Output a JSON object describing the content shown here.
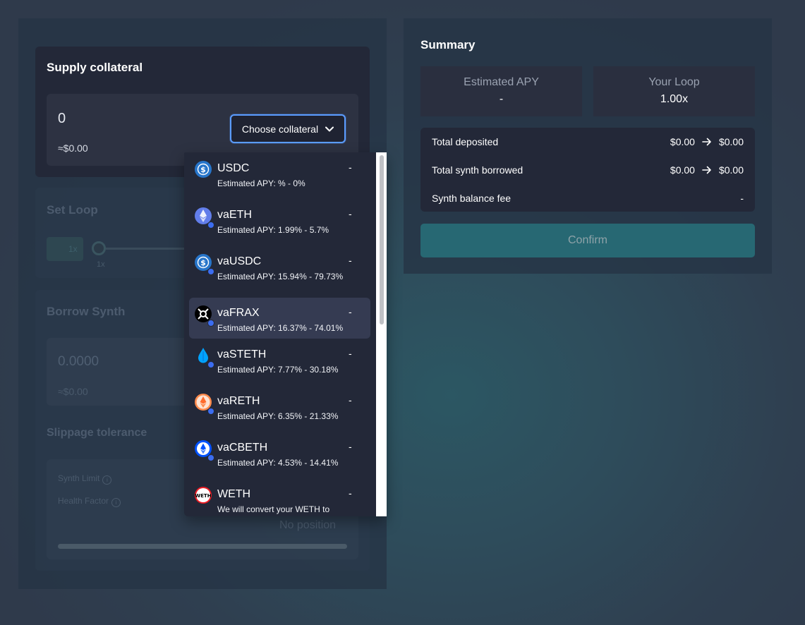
{
  "supply": {
    "title": "Supply collateral",
    "amount": "0",
    "usd": "≈$0.00",
    "choose_label": "Choose collateral"
  },
  "loop": {
    "title": "Set Loop",
    "chip_value": "1x",
    "slider_min": "1x"
  },
  "borrow": {
    "title": "Borrow Synth",
    "amount": "0.0000",
    "usd": "≈$0.00",
    "slippage_title": "Slippage tolerance",
    "synth_limit_label": "Synth Limit",
    "health_factor_label": "Health Factor",
    "no_position": "No position"
  },
  "dropdown": {
    "options": [
      {
        "name": "USDC",
        "apy": "Estimated APY: % - 0%",
        "value": "-",
        "icon": "usdc-icon",
        "color": "#2775ca"
      },
      {
        "name": "vaETH",
        "apy": "Estimated APY: 1.99% - 5.7%",
        "value": "-",
        "icon": "eth-icon",
        "color": "#627eea"
      },
      {
        "name": "vaUSDC",
        "apy": "Estimated APY: 15.94% - 79.73%",
        "value": "-",
        "icon": "usdc-icon",
        "color": "#2775ca"
      },
      {
        "name": "vaFRAX",
        "apy": "Estimated APY: 16.37% - 74.01%",
        "value": "-",
        "icon": "frax-icon",
        "color": "#000000"
      },
      {
        "name": "vaSTETH",
        "apy": "Estimated APY: 7.77% - 30.18%",
        "value": "-",
        "icon": "steth-icon",
        "color": "#00a3ff"
      },
      {
        "name": "vaRETH",
        "apy": "Estimated APY: 6.35% - 21.33%",
        "value": "-",
        "icon": "reth-icon",
        "color": "#ff8a4c"
      },
      {
        "name": "vaCBETH",
        "apy": "Estimated APY: 4.53% - 14.41%",
        "value": "-",
        "icon": "cbeth-icon",
        "color": "#0052ff"
      },
      {
        "name": "WETH",
        "apy": "We will convert your WETH to",
        "value": "-",
        "icon": "weth-icon",
        "color": "#ffffff"
      }
    ]
  },
  "summary": {
    "title": "Summary",
    "estimated_apy_label": "Estimated APY",
    "estimated_apy_value": "-",
    "your_loop_label": "Your Loop",
    "your_loop_value": "1.00x",
    "total_deposited_label": "Total deposited",
    "total_deposited_from": "$0.00",
    "total_deposited_to": "$0.00",
    "total_borrowed_label": "Total synth borrowed",
    "total_borrowed_from": "$0.00",
    "total_borrowed_to": "$0.00",
    "balance_fee_label": "Synth balance fee",
    "balance_fee_value": "-",
    "confirm_label": "Confirm"
  },
  "colors": {
    "accent": "#5b9cff",
    "confirm": "#276873"
  }
}
